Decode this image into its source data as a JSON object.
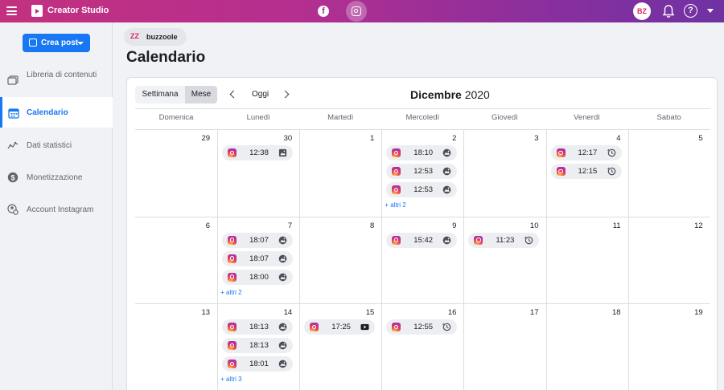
{
  "topbar": {
    "app_title": "Creator Studio",
    "platforms": [
      {
        "name": "facebook",
        "icon": "facebook-icon",
        "label": "f"
      },
      {
        "name": "instagram",
        "icon": "instagram-icon",
        "active": true
      }
    ],
    "avatar_label": "BZ",
    "help_label": "?"
  },
  "sidebar": {
    "create_button": "Crea post",
    "items": [
      {
        "label": "Libreria di contenuti",
        "icon": "library-icon"
      },
      {
        "label": "Calendario",
        "icon": "calendar-icon",
        "active": true
      },
      {
        "label": "Dati statistici",
        "icon": "insights-icon"
      },
      {
        "label": "Monetizzazione",
        "icon": "dollar-icon"
      },
      {
        "label": "Account Instagram",
        "icon": "account-settings-icon"
      }
    ]
  },
  "account": {
    "name": "buzzoole",
    "logo_text": "ZZ"
  },
  "page_title": "Calendario",
  "calendar": {
    "view_week": "Settimana",
    "view_month": "Mese",
    "active_view": "Mese",
    "today": "Oggi",
    "month_name": "Dicembre",
    "year": "2020",
    "weekdays": [
      "Domenica",
      "Lunedì",
      "Martedì",
      "Mercoledì",
      "Giovedì",
      "Venerdì",
      "Sabato"
    ],
    "weeks": [
      [
        {
          "day": "29",
          "events": []
        },
        {
          "day": "30",
          "events": [
            {
              "time": "12:38",
              "type": "image"
            }
          ]
        },
        {
          "day": "1",
          "events": []
        },
        {
          "day": "2",
          "events": [
            {
              "time": "18:10",
              "type": "photo"
            },
            {
              "time": "12:53",
              "type": "photo"
            },
            {
              "time": "12:53",
              "type": "photo"
            }
          ],
          "more": "+ altri 2"
        },
        {
          "day": "3",
          "events": []
        },
        {
          "day": "4",
          "events": [
            {
              "time": "12:17",
              "type": "scheduled"
            },
            {
              "time": "12:15",
              "type": "scheduled"
            }
          ]
        },
        {
          "day": "5",
          "events": []
        }
      ],
      [
        {
          "day": "6",
          "events": []
        },
        {
          "day": "7",
          "events": [
            {
              "time": "18:07",
              "type": "photo"
            },
            {
              "time": "18:07",
              "type": "photo"
            },
            {
              "time": "18:00",
              "type": "photo"
            }
          ],
          "more": "+ altri 2"
        },
        {
          "day": "8",
          "events": []
        },
        {
          "day": "9",
          "events": [
            {
              "time": "15:42",
              "type": "photo"
            }
          ]
        },
        {
          "day": "10",
          "events": [
            {
              "time": "11:23",
              "type": "scheduled"
            }
          ]
        },
        {
          "day": "11",
          "events": []
        },
        {
          "day": "12",
          "events": []
        }
      ],
      [
        {
          "day": "13",
          "events": []
        },
        {
          "day": "14",
          "events": [
            {
              "time": "18:13",
              "type": "photo"
            },
            {
              "time": "18:13",
              "type": "photo"
            },
            {
              "time": "18:01",
              "type": "photo"
            }
          ],
          "more": "+ altri 3"
        },
        {
          "day": "15",
          "events": [
            {
              "time": "17:25",
              "type": "video"
            }
          ]
        },
        {
          "day": "16",
          "events": [
            {
              "time": "12:55",
              "type": "scheduled"
            }
          ]
        },
        {
          "day": "17",
          "events": []
        },
        {
          "day": "18",
          "events": []
        },
        {
          "day": "19",
          "events": []
        }
      ]
    ]
  },
  "colors": {
    "topbar_start": "#c3307f",
    "topbar_end": "#6f32a3",
    "accent": "#1877f2",
    "event_pill": "#eceef1"
  }
}
